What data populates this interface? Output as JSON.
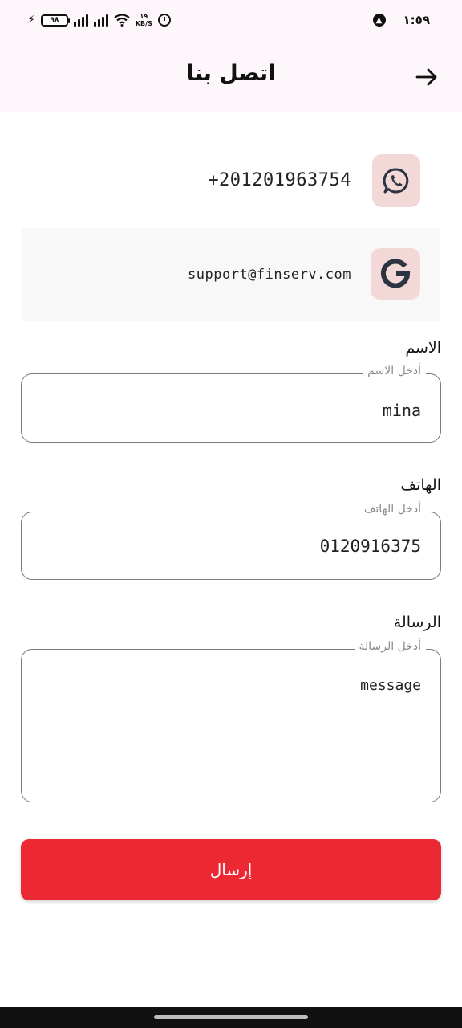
{
  "status_bar": {
    "battery": "٩٨",
    "speed_value": "١٩",
    "speed_unit": "KB/S",
    "time": "١:٥٩"
  },
  "header": {
    "title": "اتصل بنا"
  },
  "contacts": {
    "whatsapp": {
      "value": "+201201963754",
      "icon": "whatsapp-icon"
    },
    "email": {
      "value": "support@finserv.com",
      "icon": "google-icon"
    }
  },
  "form": {
    "name": {
      "label": "الاسم",
      "placeholder": "أدخل الاسم",
      "value": "mina"
    },
    "phone": {
      "label": "الهاتف",
      "placeholder": "أدخل الهاتف",
      "value": "0120916375"
    },
    "message": {
      "label": "الرسالة",
      "placeholder": "أدخل الرسالة",
      "value": "message"
    },
    "submit_label": "إرسال"
  },
  "colors": {
    "accent": "#ec2832",
    "icon_bg": "#f3d8d8",
    "app_bar_bg": "#fdf6fb"
  }
}
